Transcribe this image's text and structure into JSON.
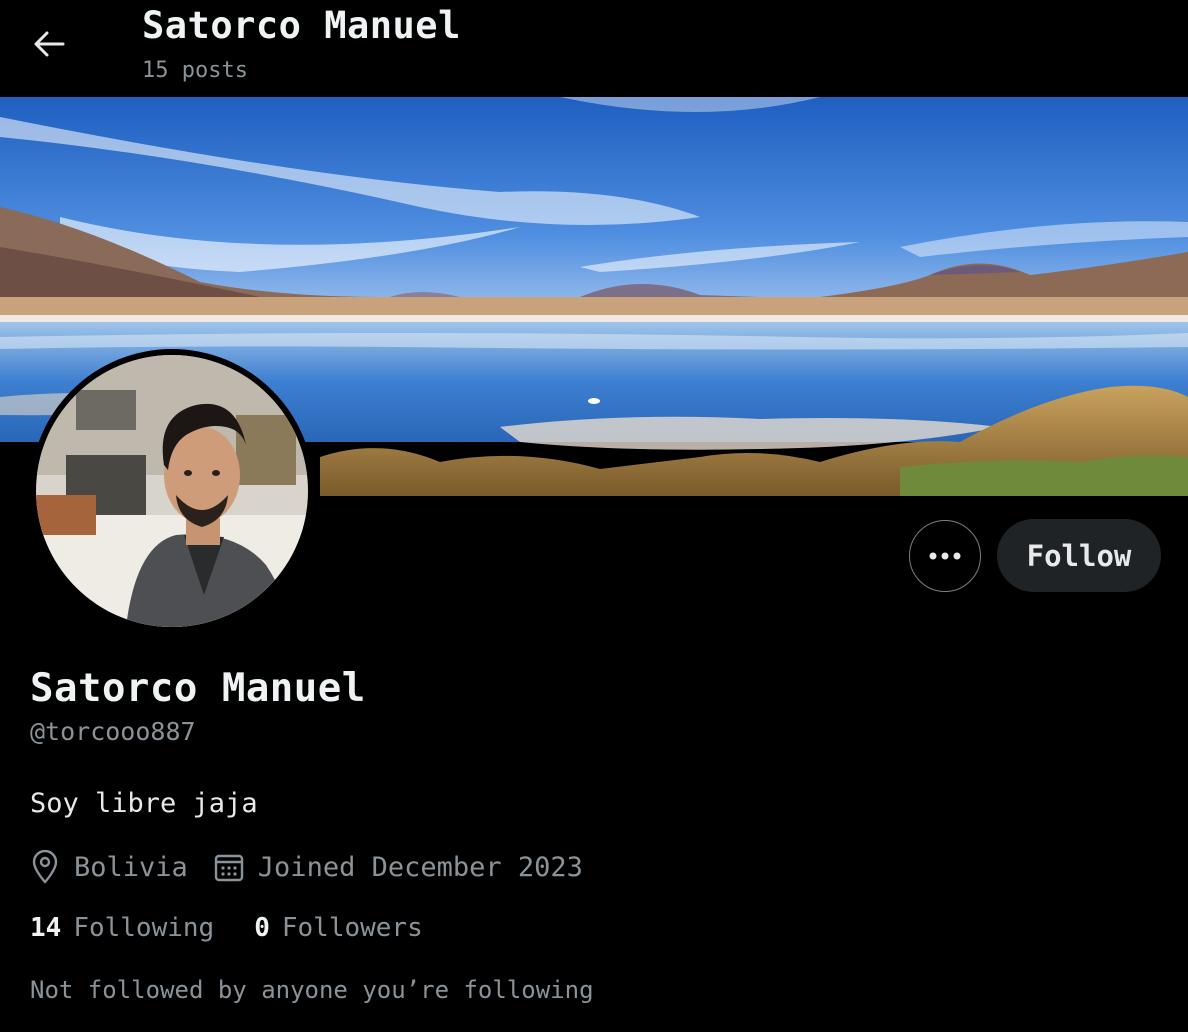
{
  "header": {
    "title": "Satorco Manuel",
    "posts_count": "15 posts"
  },
  "profile": {
    "display_name": "Satorco Manuel",
    "handle": "@torcooo887",
    "bio": "Soy libre jaja",
    "location": "Bolivia",
    "joined": "Joined December 2023",
    "following_count": "14",
    "following_label": "Following",
    "followers_count": "0",
    "followers_label": "Followers",
    "mutuals_note": "Not followed by anyone you’re following"
  },
  "actions": {
    "follow_label": "Follow"
  },
  "icons": {
    "back": "arrow-left-icon",
    "more": "more-horizontal-icon",
    "location": "location-pin-icon",
    "calendar": "calendar-icon"
  },
  "colors": {
    "background": "#000000",
    "primary_text": "#e7e9ea",
    "secondary_text": "#8b9298",
    "button_bg": "#1f2326"
  }
}
